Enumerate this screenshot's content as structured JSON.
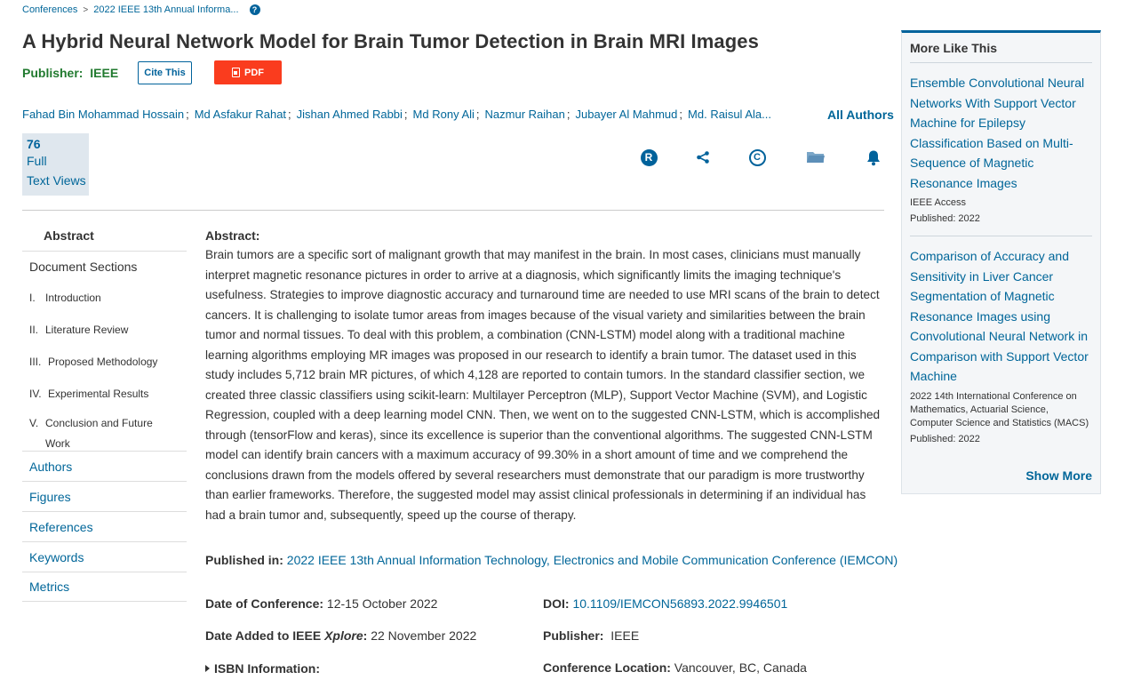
{
  "breadcrumb": {
    "items": [
      "Conferences",
      "2022 IEEE 13th Annual Informa..."
    ],
    "separator": ">",
    "help_glyph": "?"
  },
  "title": "A Hybrid Neural Network Model for Brain Tumor Detection in Brain MRI Images",
  "publisher_line": {
    "label": "Publisher:",
    "value": "IEEE"
  },
  "buttons": {
    "cite": "Cite This",
    "pdf": "PDF"
  },
  "authors": {
    "list": [
      "Fahad Bin Mohammad Hossain",
      "Md Asfakur Rahat",
      "Jishan Ahmed Rabbi",
      "Md Rony Ali",
      "Nazmur Raihan",
      "Jubayer Al Mahmud",
      "Md. Raisul Ala..."
    ],
    "all_label": "All Authors"
  },
  "views": {
    "count": "76",
    "line1": "Full",
    "line2": "Text Views"
  },
  "metric_icons": [
    "rights-icon",
    "share-icon",
    "copyright-icon",
    "folder-icon",
    "bell-icon"
  ],
  "sidenav": {
    "abstract": "Abstract",
    "document_sections": "Document Sections",
    "sections": [
      {
        "num": "I.",
        "label": "Introduction"
      },
      {
        "num": "II.",
        "label": "Literature Review"
      },
      {
        "num": "III.",
        "label": "Proposed Methodology"
      },
      {
        "num": "IV.",
        "label": "Experimental Results"
      },
      {
        "num": "V.",
        "label": "Conclusion and Future Work"
      }
    ],
    "links": [
      "Authors",
      "Figures",
      "References",
      "Keywords",
      "Metrics"
    ]
  },
  "abstract": {
    "heading": "Abstract:",
    "text": "Brain tumors are a specific sort of malignant growth that may manifest in the brain. In most cases, clinicians must manually interpret magnetic resonance pictures in order to arrive at a diagnosis, which significantly limits the imaging technique's usefulness. Strategies to improve diagnostic accuracy and turnaround time are needed to use MRI scans of the brain to detect cancers. It is challenging to isolate tumor areas from images because of the visual variety and similarities between the brain tumor and normal tissues. To deal with this problem, a combination (CNN-LSTM) model along with a traditional machine learning algorithms employing MR images was proposed in our research to identify a brain tumor. The dataset used in this study includes 5,712 brain MR pictures, of which 4,128 are reported to contain tumors. In the standard classifier section, we created three classic classifiers using scikit-learn: Multilayer Perceptron (MLP), Support Vector Machine (SVM), and Logistic Regression, coupled with a deep learning model CNN. Then, we went on to the suggested CNN-LSTM, which is accomplished through (tensorFlow and keras), since its excellence is superior than the conventional algorithms. The suggested CNN-LSTM model can identify brain cancers with a maximum accuracy of 99.30% in a short amount of time and we comprehend the conclusions drawn from the models offered by several researchers must demonstrate that our paradigm is more trustworthy than earlier frameworks. Therefore, the suggested model may assist clinical professionals in determining if an individual has had a brain tumor and, subsequently, speed up the course of therapy."
  },
  "meta": {
    "published_in_label": "Published in:",
    "published_in_value": "2022 IEEE 13th Annual Information Technology, Electronics and Mobile Communication Conference (IEMCON)",
    "date_conf_label": "Date of Conference:",
    "date_conf_value": "12-15 October 2022",
    "date_added_label_a": "Date Added to IEEE ",
    "date_added_label_b": "Xplore",
    "date_added_label_c": ":",
    "date_added_value": "22 November 2022",
    "isbn_label": "ISBN Information:",
    "doi_label": "DOI:",
    "doi_value": "10.1109/IEMCON56893.2022.9946501",
    "publisher_label": "Publisher:",
    "publisher_value": "IEEE",
    "location_label": "Conference Location:",
    "location_value": "Vancouver, BC, Canada"
  },
  "more_like_this": {
    "title": "More Like This",
    "items": [
      {
        "title": "Ensemble Convolutional Neural Networks With Support Vector Machine for Epilepsy Classification Based on Multi-Sequence of Magnetic Resonance Images",
        "venue": "IEEE Access",
        "published": "Published: 2022"
      },
      {
        "title": "Comparison of Accuracy and Sensitivity in Liver Cancer Segmentation of Magnetic Resonance Images using Convolutional Neural Network in Comparison with Support Vector Machine",
        "venue": "2022 14th International Conference on Mathematics, Actuarial Science, Computer Science and Statistics (MACS)",
        "published": "Published: 2022"
      }
    ],
    "show_more": "Show More"
  },
  "colors": {
    "link": "#006699",
    "brand": "#00629b",
    "publisher_green": "#217a2f",
    "pdf_red": "#fa3c1e"
  }
}
